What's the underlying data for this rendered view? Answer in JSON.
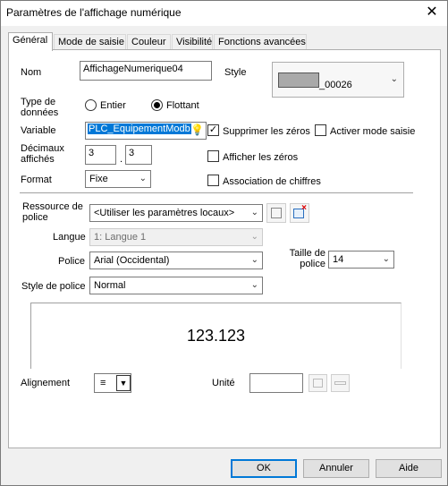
{
  "window": {
    "title": "Paramètres de l'affichage numérique",
    "close": "✕"
  },
  "tabs": [
    {
      "label": "Général"
    },
    {
      "label": "Mode de saisie"
    },
    {
      "label": "Couleur"
    },
    {
      "label": "Visibilité"
    },
    {
      "label": "Fonctions avancées"
    }
  ],
  "form": {
    "nom_label": "Nom",
    "nom_value": "AffichageNumerique04",
    "style_label": "Style",
    "style_value": "_00026",
    "type_label": "Type de données",
    "type_options": [
      "Entier",
      "Flottant"
    ],
    "type_selected": "Flottant",
    "variable_label": "Variable",
    "variable_value": "PLC_EquipementModb",
    "supprimer_zeros": {
      "label": "Supprimer les zéros",
      "checked": true
    },
    "activer_saisie": {
      "label": "Activer mode saisie",
      "checked": false
    },
    "decimaux_label": "Décimaux affichés",
    "decimaux_int": "3",
    "decimaux_sep": ".",
    "decimaux_frac": "3",
    "afficher_zeros": {
      "label": "Afficher les zéros",
      "checked": false
    },
    "format_label": "Format",
    "format_value": "Fixe",
    "association": {
      "label": "Association de chiffres",
      "checked": false
    }
  },
  "font": {
    "ressource_label": "Ressource de police",
    "ressource_value": "<Utiliser les paramètres locaux>",
    "langue_label": "Langue",
    "langue_value": "1: Langue 1",
    "police_label": "Police",
    "police_value": "Arial (Occidental)",
    "taille_label": "Taille de police",
    "taille_value": "14",
    "style_label": "Style de police",
    "style_value": "Normal"
  },
  "preview": {
    "text": "123.123"
  },
  "bottom": {
    "alignement_label": "Alignement",
    "unite_label": "Unité",
    "unite_value": ""
  },
  "buttons": {
    "ok": "OK",
    "cancel": "Annuler",
    "help": "Aide"
  },
  "colors": {
    "accent": "#0078d7",
    "selection": "#0078d7"
  }
}
